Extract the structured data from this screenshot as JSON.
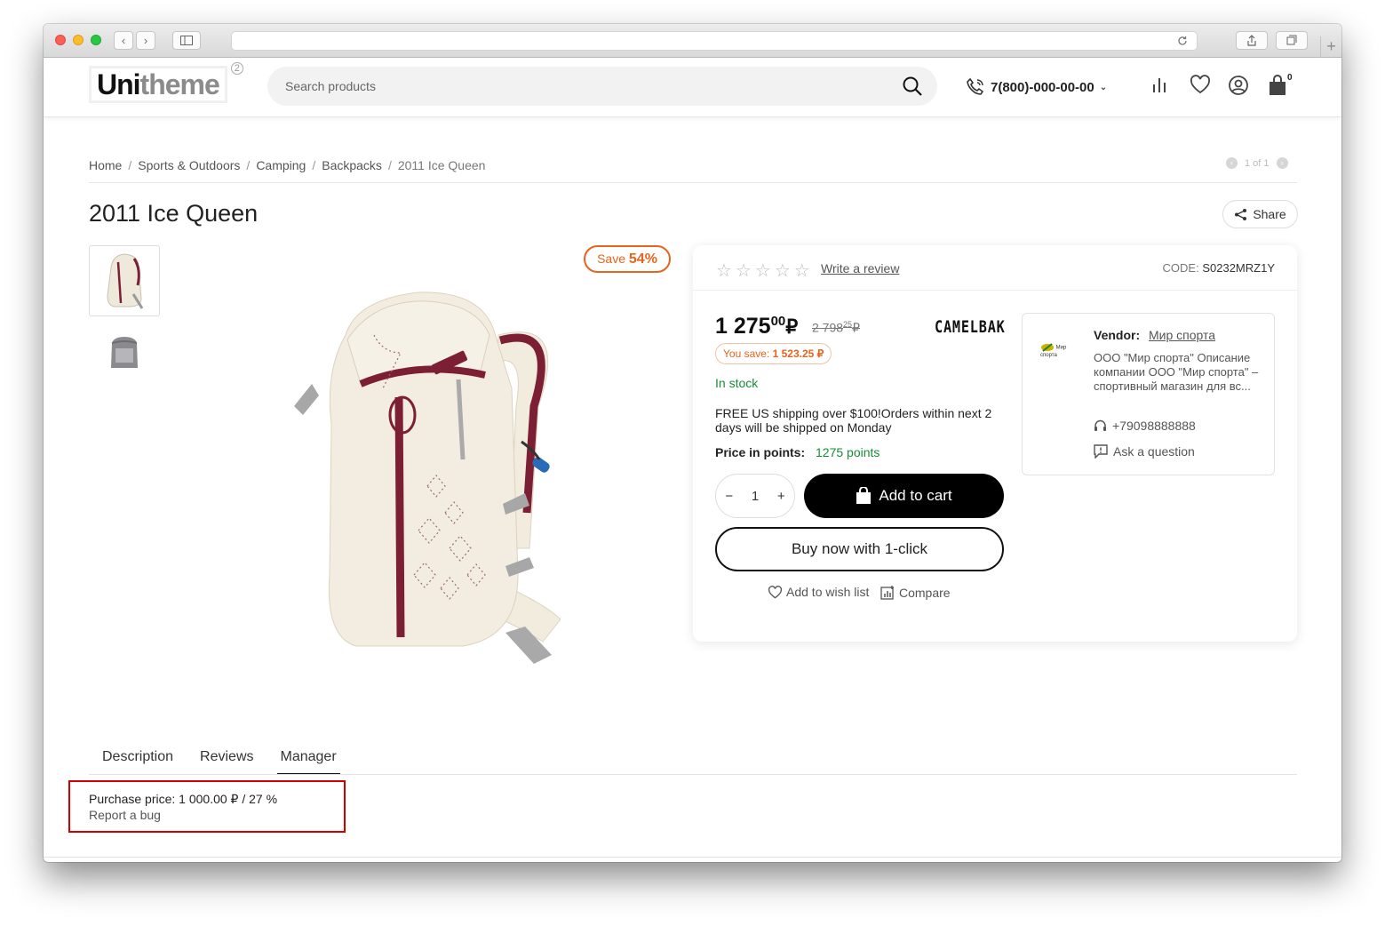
{
  "header": {
    "logo_main": "Uni",
    "logo_rest": "theme",
    "logo_badge": "2",
    "search_placeholder": "Search products",
    "phone": "7(800)-000-00-00",
    "cart_count": "0"
  },
  "breadcrumb": {
    "items": [
      "Home",
      "Sports & Outdoors",
      "Camping",
      "Backpacks"
    ],
    "current": "2011 Ice Queen",
    "pager": "1 of 1"
  },
  "product": {
    "title": "2011 Ice Queen",
    "share_label": "Share",
    "save_prefix": "Save",
    "save_percent": "54%",
    "rating_value": 0,
    "rating_max": 5,
    "write_review": "Write a review",
    "code_label": "CODE:",
    "code_value": "S0232MRZ1Y",
    "price_main": "1 275",
    "price_cents": "00",
    "price_currency": "₽",
    "old_price_main": "2 798",
    "old_price_cents": "25",
    "old_price_currency": "₽",
    "brand": "CAMELBAK",
    "you_save_label": "You save:",
    "you_save_value": "1 523.25 ₽",
    "stock": "In stock",
    "shipping": "FREE US shipping over $100!Orders within next 2 days will be shipped on Monday",
    "points_label": "Price in points:",
    "points_value": "1275 points",
    "quantity": "1",
    "add_to_cart": "Add to cart",
    "buy_now": "Buy now with 1-click",
    "add_to_wishlist": "Add to wish list",
    "compare": "Compare"
  },
  "vendor": {
    "label": "Vendor:",
    "name": "Мир спорта",
    "logo_text": "Мир спорта",
    "description": "ООО \"Мир спорта\" Описание компании ООО \"Мир спорта\" – спортивный магазин для вс...",
    "phone": "+79098888888",
    "ask": "Ask a question"
  },
  "tabs": [
    "Description",
    "Reviews",
    "Manager"
  ],
  "active_tab": "Manager",
  "manager": {
    "purchase_price": "Purchase price: 1 000.00 ₽ / 27 %",
    "report_bug": "Report a bug"
  },
  "colors": {
    "accent_orange": "#e8631c",
    "in_stock_green": "#1a8a3a",
    "highlight_red": "#d40000"
  }
}
